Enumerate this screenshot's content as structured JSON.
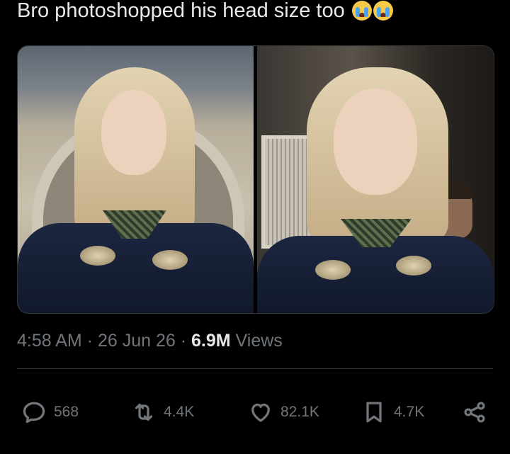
{
  "post": {
    "text": "Bro photoshopped his head size too",
    "emojis": [
      "loudly-crying-face",
      "loudly-crying-face"
    ]
  },
  "media": {
    "images": [
      {
        "label": "left-photo"
      },
      {
        "label": "right-photo"
      }
    ]
  },
  "meta": {
    "time": "4:58 AM",
    "sep1": " · ",
    "date": "26 Jun 26",
    "sep2": " · ",
    "views_count": "6.9M",
    "views_label": " Views"
  },
  "actions": {
    "reply": {
      "icon": "reply-icon",
      "count": "568"
    },
    "repost": {
      "icon": "repost-icon",
      "count": "4.4K"
    },
    "like": {
      "icon": "heart-icon",
      "count": "82.1K"
    },
    "bookmark": {
      "icon": "bookmark-icon",
      "count": "4.7K"
    },
    "share": {
      "icon": "share-icon"
    }
  },
  "colors": {
    "background": "#000000",
    "text_primary": "#e7e9ea",
    "text_secondary": "#71767b",
    "border": "#2f3336"
  }
}
